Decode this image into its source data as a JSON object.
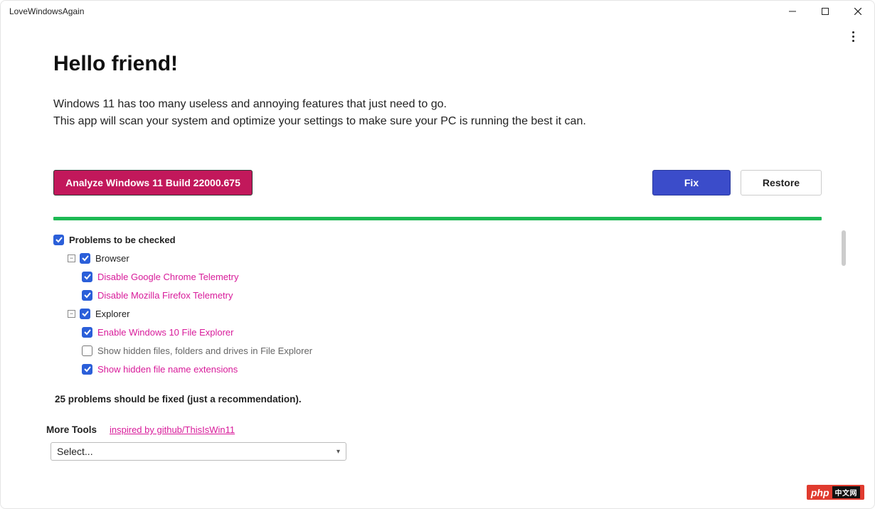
{
  "window": {
    "title": "LoveWindowsAgain"
  },
  "header": {
    "title": "Hello friend!",
    "intro_line1": "Windows 11 has too many useless and annoying features that just need to go.",
    "intro_line2": "This app will scan your system and optimize your settings to make sure your PC is running the best it can."
  },
  "buttons": {
    "analyze": "Analyze Windows 11 Build 22000.675",
    "fix": "Fix",
    "restore": "Restore"
  },
  "tree": {
    "root_label": "Problems to be checked",
    "groups": [
      {
        "label": "Browser",
        "checked": true,
        "items": [
          {
            "label": "Disable Google Chrome Telemetry",
            "checked": true,
            "highlight": true
          },
          {
            "label": "Disable Mozilla Firefox Telemetry",
            "checked": true,
            "highlight": true
          }
        ]
      },
      {
        "label": "Explorer",
        "checked": true,
        "items": [
          {
            "label": "Enable Windows 10 File Explorer",
            "checked": true,
            "highlight": true
          },
          {
            "label": "Show hidden files, folders and drives in File Explorer",
            "checked": false,
            "highlight": false
          },
          {
            "label": "Show hidden file name extensions",
            "checked": true,
            "highlight": true
          }
        ]
      }
    ]
  },
  "summary": "25 problems should be fixed (just a recommendation).",
  "more_tools": {
    "label": "More Tools",
    "link": "inspired by github/ThisIsWin11",
    "select_placeholder": "Select..."
  },
  "watermark": {
    "text": "php",
    "suffix": "中文网"
  }
}
